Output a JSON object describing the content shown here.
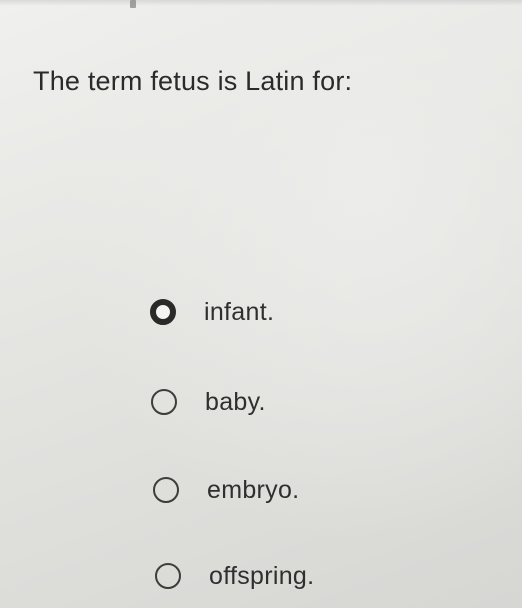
{
  "question": {
    "text": "The term fetus is Latin for:"
  },
  "options": [
    {
      "label": "infant.",
      "selected": true
    },
    {
      "label": "baby.",
      "selected": false
    },
    {
      "label": "embryo.",
      "selected": false
    },
    {
      "label": "offspring.",
      "selected": false
    }
  ],
  "colors": {
    "background": "#e4e4e1",
    "text": "#2f2f2f",
    "radio": "#3d3d3d"
  }
}
